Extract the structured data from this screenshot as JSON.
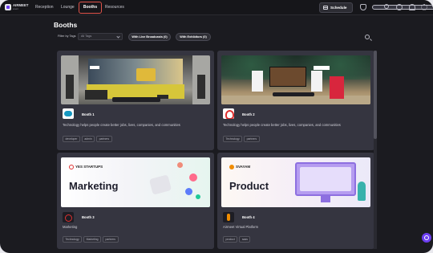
{
  "app": {
    "logo_name": "AIRMEET",
    "logo_sub": "event"
  },
  "nav": {
    "items": [
      {
        "label": "Reception"
      },
      {
        "label": "Lounge"
      },
      {
        "label": "Booths",
        "active": true
      },
      {
        "label": "Resources"
      }
    ],
    "schedule_label": "Schedule",
    "icons": [
      "shield-icon",
      "ticket-icon",
      "people-icon",
      "chat-icon",
      "bell-icon",
      "gear-icon"
    ]
  },
  "page": {
    "title": "Booths"
  },
  "filters": {
    "label": "Filter by Tags",
    "select_value": "All Tags",
    "live_broadcasts_label": "With Live Broadcasts (0)",
    "exhibitors_label": "With Exhibitors (0)"
  },
  "booths": [
    {
      "name": "Booth 1",
      "description": "Technology helps people create better jobs, lives, companies, and communities",
      "tags": [
        "developer",
        "admin",
        "partners"
      ],
      "logo": "salesforce-cloud-icon"
    },
    {
      "name": "Booth 2",
      "description": "Technology helps people create better jobs, lives, companies, and communities",
      "tags": [
        "Technology",
        "partners"
      ],
      "logo": "red-mascot-icon"
    },
    {
      "name": "Booth 3",
      "description": "Marketing",
      "tags": [
        "Technology",
        "Marketing",
        "partners"
      ],
      "logo": "red-circle-icon",
      "banner_brand": "YES STARTUPS",
      "banner_title": "Marketing"
    },
    {
      "name": "Booth 4",
      "description": "Airmeet Virtual Platform",
      "tags": [
        "product",
        "saas"
      ],
      "logo": "orange-candle-icon",
      "banner_brand": "SVAYAM",
      "banner_title": "Product"
    }
  ],
  "colors": {
    "accent": "#6c3ef0",
    "active_tab_outline": "#e0534a",
    "background": "#1b1b20",
    "card": "#353540"
  }
}
